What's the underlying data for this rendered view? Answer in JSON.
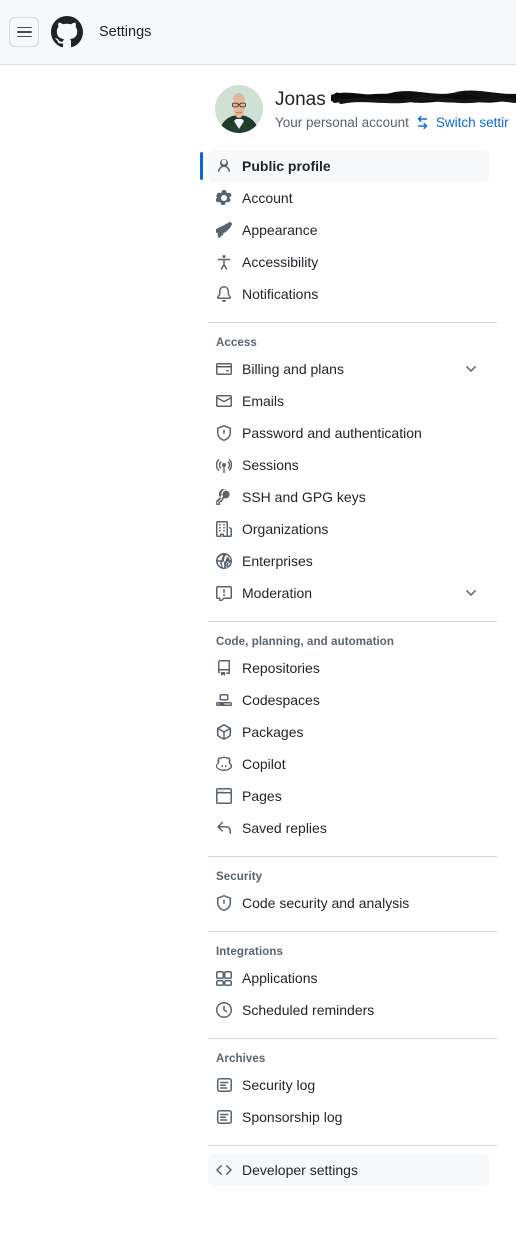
{
  "header": {
    "title": "Settings",
    "menu_label": "Open menu",
    "logo_label": "GitHub"
  },
  "account": {
    "name_visible": "Jonas",
    "name_redacted": true,
    "subtitle": "Your personal account",
    "switch_link": "Switch settir",
    "switch_icon": "switch-arrows-icon"
  },
  "colors": {
    "accent": "#0969da",
    "selected_bg": "#f6f8fa",
    "header_bg": "#f6f8fa",
    "border": "#d1d9e0",
    "text": "#1f2328",
    "muted": "#59636e"
  },
  "nav": {
    "groups": [
      {
        "title": null,
        "divider_after": true,
        "items": [
          {
            "label": "Public profile",
            "icon": "person-icon",
            "selected": true,
            "chevron": false
          },
          {
            "label": "Account",
            "icon": "gear-icon",
            "selected": false,
            "chevron": false
          },
          {
            "label": "Appearance",
            "icon": "paintbrush-icon",
            "selected": false,
            "chevron": false
          },
          {
            "label": "Accessibility",
            "icon": "accessibility-icon",
            "selected": false,
            "chevron": false
          },
          {
            "label": "Notifications",
            "icon": "bell-icon",
            "selected": false,
            "chevron": false
          }
        ]
      },
      {
        "title": "Access",
        "divider_after": true,
        "items": [
          {
            "label": "Billing and plans",
            "icon": "credit-card-icon",
            "selected": false,
            "chevron": true
          },
          {
            "label": "Emails",
            "icon": "mail-icon",
            "selected": false,
            "chevron": false
          },
          {
            "label": "Password and authentication",
            "icon": "shield-lock-icon",
            "selected": false,
            "chevron": false
          },
          {
            "label": "Sessions",
            "icon": "broadcast-icon",
            "selected": false,
            "chevron": false
          },
          {
            "label": "SSH and GPG keys",
            "icon": "key-icon",
            "selected": false,
            "chevron": false
          },
          {
            "label": "Organizations",
            "icon": "organization-icon",
            "selected": false,
            "chevron": false
          },
          {
            "label": "Enterprises",
            "icon": "globe-icon",
            "selected": false,
            "chevron": false
          },
          {
            "label": "Moderation",
            "icon": "report-icon",
            "selected": false,
            "chevron": true
          }
        ]
      },
      {
        "title": "Code, planning, and automation",
        "divider_after": true,
        "items": [
          {
            "label": "Repositories",
            "icon": "repo-icon",
            "selected": false,
            "chevron": false
          },
          {
            "label": "Codespaces",
            "icon": "codespaces-icon",
            "selected": false,
            "chevron": false
          },
          {
            "label": "Packages",
            "icon": "package-icon",
            "selected": false,
            "chevron": false
          },
          {
            "label": "Copilot",
            "icon": "copilot-icon",
            "selected": false,
            "chevron": false
          },
          {
            "label": "Pages",
            "icon": "browser-icon",
            "selected": false,
            "chevron": false
          },
          {
            "label": "Saved replies",
            "icon": "reply-icon",
            "selected": false,
            "chevron": false
          }
        ]
      },
      {
        "title": "Security",
        "divider_after": true,
        "items": [
          {
            "label": "Code security and analysis",
            "icon": "shield-check-icon",
            "selected": false,
            "chevron": false
          }
        ]
      },
      {
        "title": "Integrations",
        "divider_after": true,
        "items": [
          {
            "label": "Applications",
            "icon": "apps-icon",
            "selected": false,
            "chevron": false
          },
          {
            "label": "Scheduled reminders",
            "icon": "clock-icon",
            "selected": false,
            "chevron": false
          }
        ]
      },
      {
        "title": "Archives",
        "divider_after": true,
        "items": [
          {
            "label": "Security log",
            "icon": "log-icon",
            "selected": false,
            "chevron": false
          },
          {
            "label": "Sponsorship log",
            "icon": "log-icon",
            "selected": false,
            "chevron": false
          }
        ]
      },
      {
        "title": null,
        "divider_after": false,
        "items": [
          {
            "label": "Developer settings",
            "icon": "code-icon",
            "selected": false,
            "filled": true,
            "chevron": false
          }
        ]
      }
    ]
  }
}
